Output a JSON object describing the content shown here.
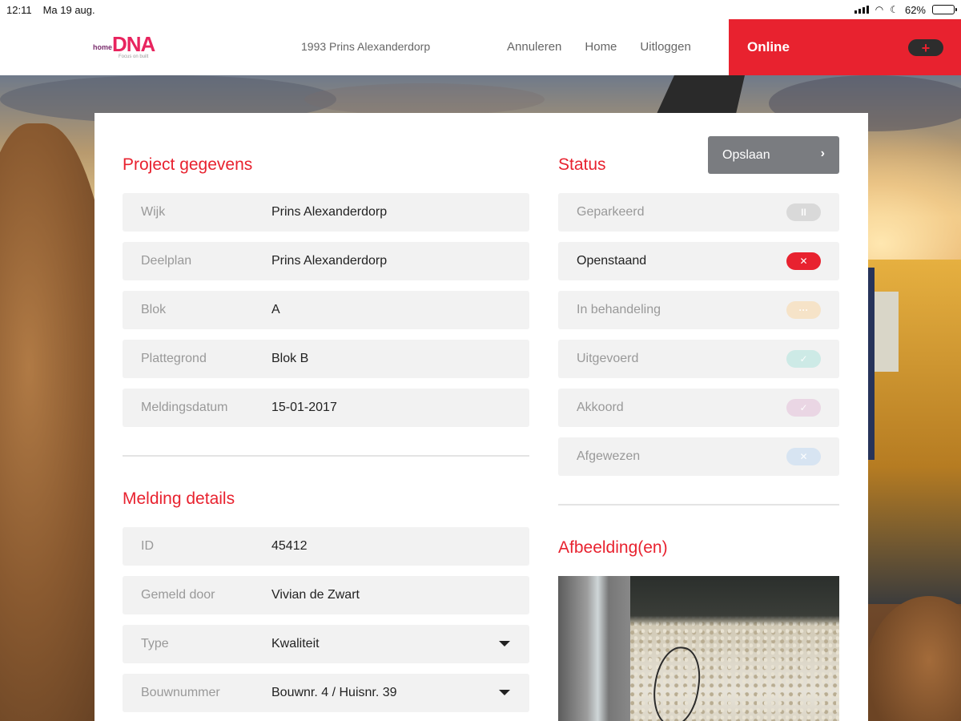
{
  "statusbar": {
    "time": "12:11",
    "date": "Ma 19 aug.",
    "battery_text": "62%",
    "battery_level": 0.62
  },
  "header": {
    "logo": {
      "prefix": "home",
      "name": "DNA",
      "tagline": "Focus on built"
    },
    "project": "1993 Prins Alexanderdorp",
    "nav": [
      "Annuleren",
      "Home",
      "Uitloggen"
    ],
    "online_label": "Online",
    "plus_label": "+"
  },
  "project_section": {
    "title": "Project gegevens",
    "rows": [
      {
        "label": "Wijk",
        "value": "Prins Alexanderdorp"
      },
      {
        "label": "Deelplan",
        "value": "Prins Alexanderdorp"
      },
      {
        "label": "Blok",
        "value": "A"
      },
      {
        "label": "Plattegrond",
        "value": "Blok B"
      },
      {
        "label": "Meldingsdatum",
        "value": "15-01-2017"
      }
    ]
  },
  "details_section": {
    "title": "Melding details",
    "rows": [
      {
        "label": "ID",
        "value": "45412"
      },
      {
        "label": "Gemeld door",
        "value": "Vivian de Zwart"
      },
      {
        "label": "Type",
        "value": "Kwaliteit"
      },
      {
        "label": "Bouwnummer",
        "value": "Bouwnr. 4 / Huisnr. 39"
      }
    ]
  },
  "status_section": {
    "title": "Status",
    "save_label": "Opslaan",
    "items": [
      {
        "label": "Geparkeerd",
        "icon": "pause-icon",
        "glyph": "II",
        "color": "#d9d9d9",
        "active": false
      },
      {
        "label": "Openstaand",
        "icon": "close-icon",
        "glyph": "✕",
        "color": "#e8222f",
        "active": true
      },
      {
        "label": "In behandeling",
        "icon": "ellipsis-icon",
        "glyph": "···",
        "color": "#f6e3c8",
        "active": false
      },
      {
        "label": "Uitgevoerd",
        "icon": "check-icon",
        "glyph": "✓",
        "color": "#cdeae6",
        "active": false
      },
      {
        "label": "Akkoord",
        "icon": "check-icon",
        "glyph": "✓",
        "color": "#ead6e4",
        "active": false
      },
      {
        "label": "Afgewezen",
        "icon": "close-icon",
        "glyph": "✕",
        "color": "#d7e4f2",
        "active": false
      }
    ]
  },
  "images_section": {
    "title": "Afbeelding(en)"
  }
}
